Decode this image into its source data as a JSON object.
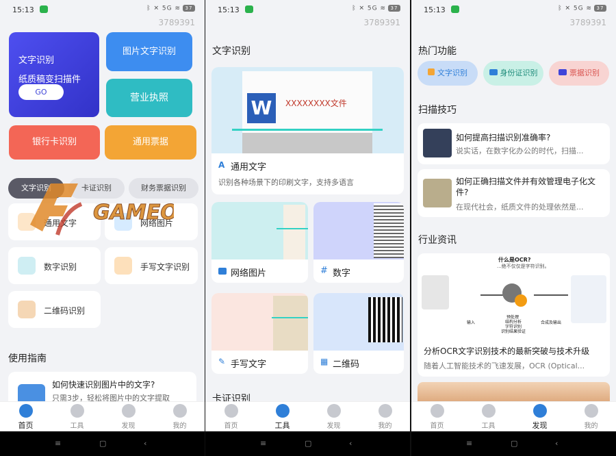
{
  "status": {
    "time": "15:13",
    "icons": "ᛒ ✕ 5G ≋",
    "battery": "37"
  },
  "uid": "3789391",
  "home": {
    "card_main_title": "文字识别",
    "card_main_sub": "纸质稿变扫描件",
    "card_main_go": "GO",
    "card_image": "图片文字识别",
    "card_license": "营业执照",
    "card_bank": "银行卡识别",
    "card_ticket": "通用票据",
    "tabs": [
      "文字识别",
      "卡证识别",
      "财务票据识别"
    ],
    "tiles": [
      {
        "label": "通用文字"
      },
      {
        "label": "网络图片"
      },
      {
        "label": "数字识别"
      },
      {
        "label": "手写文字识别"
      },
      {
        "label": "二维码识别"
      }
    ],
    "guide_title": "使用指南",
    "guide_item_title": "如何快速识别图片中的文字?",
    "guide_item_desc": "只需3步，轻松将图片中的文字提取"
  },
  "tools": {
    "section": "文字识别",
    "doc_icon": "W",
    "doc_title": "XXXXXXXX文件",
    "general_title": "通用文字",
    "general_desc": "识别各种场景下的印刷文字，支持多语言",
    "web_label": "网络图片",
    "digit_label": "数字",
    "hand_label": "手写文字",
    "qr_label": "二维码",
    "next_section": "卡证识别"
  },
  "discover": {
    "hot_title": "热门功能",
    "hot": [
      "文字识别",
      "身份证识别",
      "票据识别"
    ],
    "tips_title": "扫描技巧",
    "tips": [
      {
        "title": "如何提高扫描识别准确率?",
        "desc": "说实话，在数字化办公的时代，扫描..."
      },
      {
        "title": "如何正确扫描文件并有效管理电子化文件?",
        "desc": "在现代社会，纸质文件的处理依然是..."
      }
    ],
    "news_title": "行业资讯",
    "ocr_heading": "什么是OCR?",
    "ocr_sub": "...绝不仅仅是字符识别。",
    "ocr_labels": [
      "输入",
      "预处理",
      "结构分析",
      "字符识别",
      "识别结果验证",
      "合成及输出"
    ],
    "news_item_title": "分析OCR文字识别技术的最新突破与技术升级",
    "news_item_desc": "随着人工智能技术的飞速发展，OCR (Optical..."
  },
  "tabbar": [
    "首页",
    "工具",
    "发现",
    "我的"
  ],
  "watermark": "GAMEO",
  "colors": {
    "blue": "#2f7fd8",
    "purple": "#3f45d9",
    "red": "#f26357",
    "orange": "#f3a535",
    "teal": "#33bfc6"
  }
}
